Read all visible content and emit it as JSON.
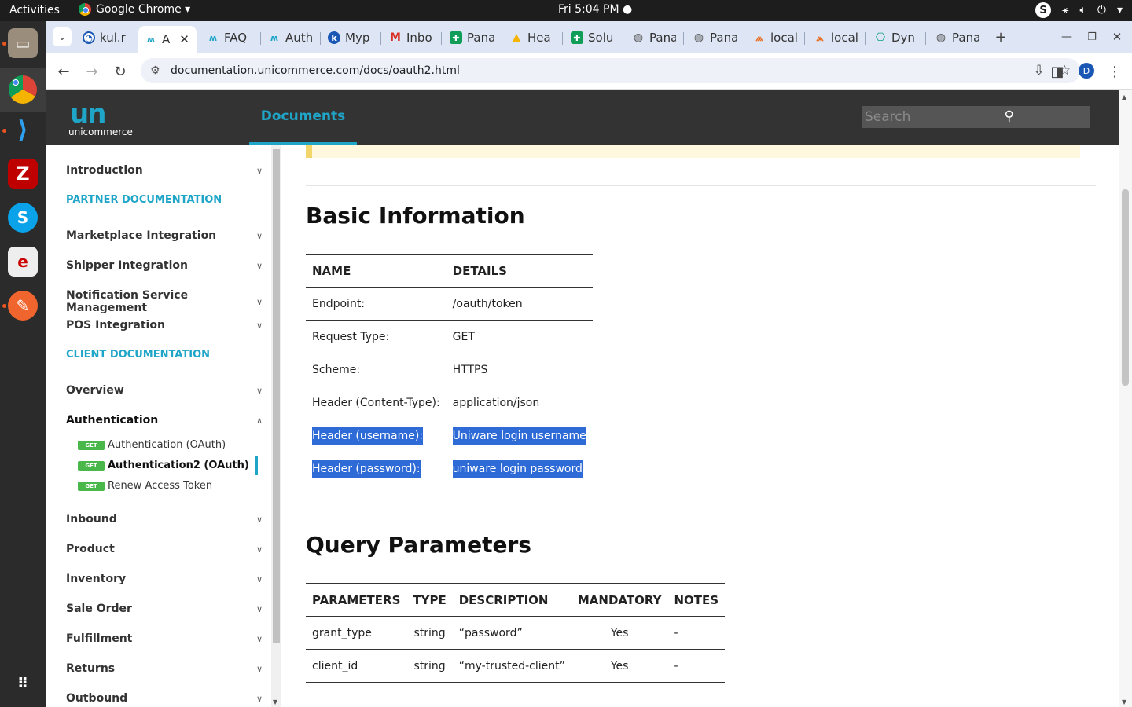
{
  "system": {
    "activities": "Activities",
    "app_name": "Google Chrome ▾",
    "clock": "Fri  5:04 PM ●"
  },
  "tabs": [
    {
      "label": "kul.r",
      "icon": "k-icon"
    },
    {
      "label": "A",
      "icon": "unicommerce-icon",
      "active": true
    },
    {
      "label": "FAQ",
      "icon": "unicommerce-icon"
    },
    {
      "label": "Auth",
      "icon": "unicommerce-icon"
    },
    {
      "label": "Myp",
      "icon": "k-icon"
    },
    {
      "label": "Inbo",
      "icon": "gmail-icon"
    },
    {
      "label": "Pana",
      "icon": "sheets-icon"
    },
    {
      "label": "Hea",
      "icon": "drive-icon"
    },
    {
      "label": "Solu",
      "icon": "sheets-icon"
    },
    {
      "label": "Pana",
      "icon": "globe-icon"
    },
    {
      "label": "Pana",
      "icon": "globe-icon"
    },
    {
      "label": "local",
      "icon": "pma-icon"
    },
    {
      "label": "local",
      "icon": "pma-icon"
    },
    {
      "label": "Dyn",
      "icon": "chatgpt-icon"
    },
    {
      "label": "Pana",
      "icon": "globe-icon"
    }
  ],
  "address": {
    "url": "documentation.unicommerce.com/docs/oauth2.html",
    "profile_initial": "D"
  },
  "header": {
    "logo_word": "unicommerce",
    "docs_tab": "Documents",
    "search_placeholder": "Search"
  },
  "sidebar": {
    "introduction": "Introduction",
    "partner_section": "PARTNER DOCUMENTATION",
    "marketplace": "Marketplace Integration",
    "shipper": "Shipper Integration",
    "notification": "Notification Service Management",
    "pos": "POS Integration",
    "client_section": "CLIENT DOCUMENTATION",
    "overview": "Overview",
    "authentication": "Authentication",
    "auth_sub": [
      {
        "badge": "GET",
        "label": "Authentication (OAuth)"
      },
      {
        "badge": "GET",
        "label": "Authentication2 (OAuth)"
      },
      {
        "badge": "GET",
        "label": "Renew Access Token"
      }
    ],
    "inbound": "Inbound",
    "product": "Product",
    "inventory": "Inventory",
    "sale_order": "Sale Order",
    "fulfillment": "Fulfillment",
    "returns": "Returns",
    "outbound": "Outbound"
  },
  "basic_info": {
    "title": "Basic Information",
    "headers": [
      "NAME",
      "DETAILS"
    ],
    "rows": [
      [
        "Endpoint:",
        "/oauth/token"
      ],
      [
        "Request Type:",
        "GET"
      ],
      [
        "Scheme:",
        "HTTPS"
      ],
      [
        "Header (Content-Type):",
        "application/json"
      ],
      [
        "Header (username):",
        "Uniware login username"
      ],
      [
        "Header (password):",
        "uniware login password"
      ]
    ]
  },
  "query_params": {
    "title": "Query Parameters",
    "headers": [
      "PARAMETERS",
      "TYPE",
      "DESCRIPTION",
      "MANDATORY",
      "NOTES"
    ],
    "rows": [
      [
        "grant_type",
        "string",
        "“password”",
        "Yes",
        "-"
      ],
      [
        "client_id",
        "string",
        "“my-trusted-client”",
        "Yes",
        "-"
      ]
    ]
  }
}
